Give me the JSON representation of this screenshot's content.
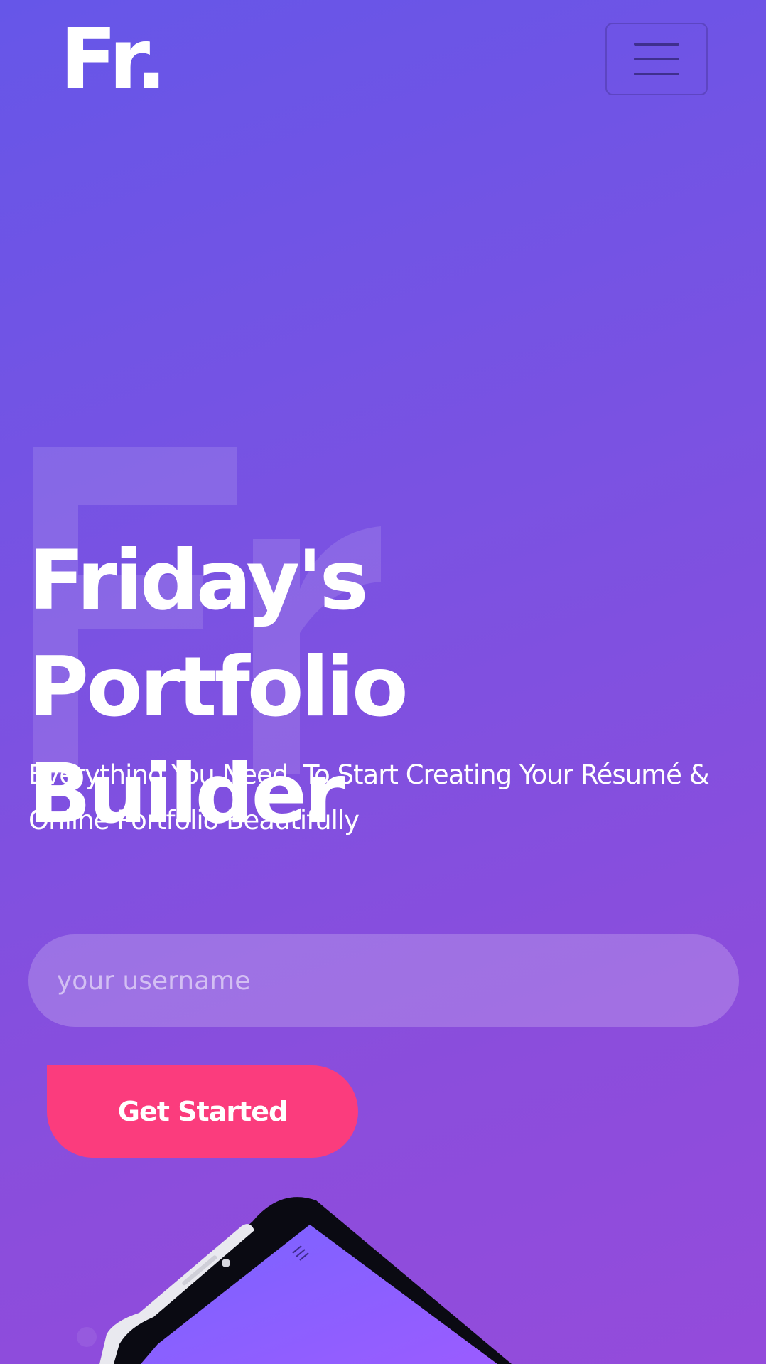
{
  "header": {
    "logo": "Fr.",
    "menu_icon": "hamburger-icon"
  },
  "hero": {
    "watermark": "Fr",
    "title": "Friday's Portfolio Builder",
    "subtitle": "Everything You Need. To Start Creating Your Résumé & Online Portfolio Beautifully"
  },
  "signup": {
    "username_placeholder": "your username",
    "username_value": "",
    "button_label": "Get Started"
  },
  "colors": {
    "background_start": "#6656e8",
    "background_end": "#944bdb",
    "cta": "#fb3c7d",
    "text": "#ffffff"
  }
}
